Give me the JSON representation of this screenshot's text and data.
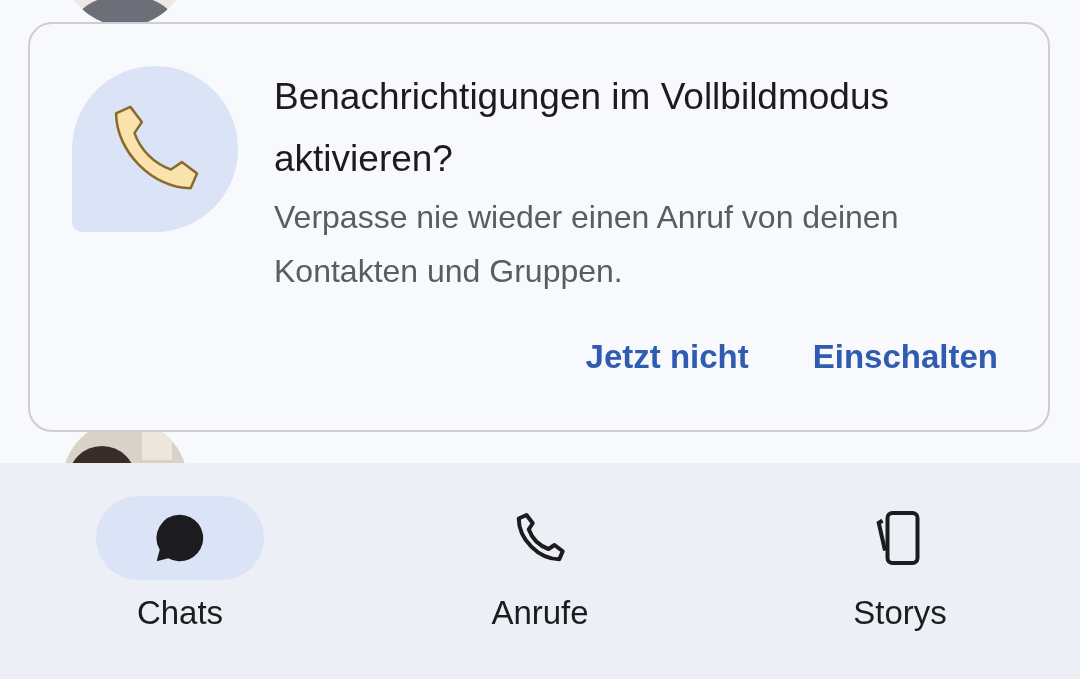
{
  "prompt": {
    "title": "Benachrichtigungen im Vollbildmodus aktivieren?",
    "message": "Verpasse nie wieder einen Anruf von deinen Kontakten und Gruppen.",
    "buttons": [
      "Jetzt nicht",
      "Einschalten"
    ]
  },
  "nav": [
    {
      "label": "Chats",
      "selected": true
    },
    {
      "label": "Anrufe",
      "selected": false
    },
    {
      "label": "Storys",
      "selected": false
    }
  ]
}
